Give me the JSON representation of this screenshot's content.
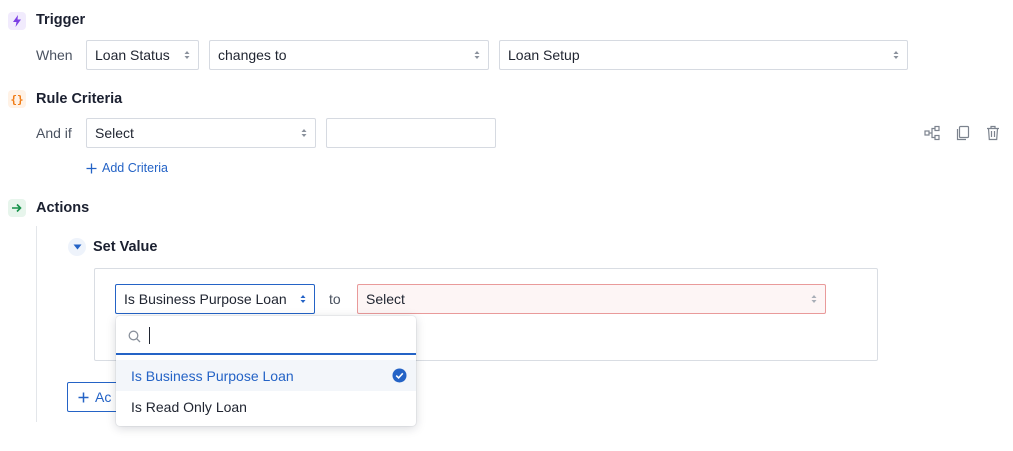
{
  "trigger": {
    "title": "Trigger",
    "when_label": "When",
    "field": "Loan Status",
    "operator": "changes to",
    "value": "Loan Setup"
  },
  "criteria": {
    "title": "Rule Criteria",
    "and_if_label": "And if",
    "field": "Select",
    "value": "",
    "add_label": "Add Criteria"
  },
  "actions": {
    "title": "Actions",
    "set_value": {
      "title": "Set Value",
      "field": "Is Business Purpose Loan",
      "to_label": "to",
      "value": "Select"
    },
    "add_action_label": "Ac"
  },
  "dropdown": {
    "search_value": "",
    "options": [
      {
        "label": "Is Business Purpose Loan",
        "selected": true
      },
      {
        "label": "Is Read Only Loan",
        "selected": false
      }
    ]
  },
  "colors": {
    "accent": "#2463c6",
    "trigger_icon": "#7b3fe4",
    "criteria_icon": "#f07b14",
    "actions_icon": "#16924a",
    "error_border": "#e99a9a"
  },
  "icons": {
    "trigger": "lightning-icon",
    "criteria": "braces-icon",
    "actions": "arrow-right-icon",
    "tools": [
      "hierarchy-icon",
      "copy-icon",
      "trash-icon"
    ]
  }
}
